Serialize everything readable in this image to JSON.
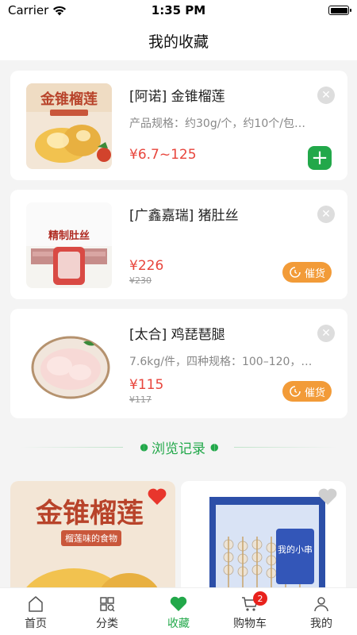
{
  "status": {
    "carrier": "Carrier",
    "time": "1:35 PM"
  },
  "page": {
    "title": "我的收藏"
  },
  "favorites": [
    {
      "title": "[阿诺] 金锥榴莲",
      "spec": "产品规格：约30g/个，约10个/包…",
      "price": "¥6.7~125",
      "old_price": "",
      "action": "add"
    },
    {
      "title": "[广鑫嘉瑞] 猪肚丝",
      "spec": "",
      "price": "¥226",
      "old_price": "¥230",
      "action": "催货"
    },
    {
      "title": "[太合] 鸡琵琶腿",
      "spec": "7.6kg/件，四种规格：100–120，…",
      "price": "¥115",
      "old_price": "¥117",
      "action": "催货"
    }
  ],
  "thumb_text": {
    "durian_title": "金锥榴莲",
    "durian_tag": "榴莲味的食物",
    "pork_label": "精制肚丝",
    "skewer_label": "我的小串"
  },
  "history": {
    "title": "浏览记录"
  },
  "tabs": [
    {
      "label": "首页",
      "icon": "home-icon"
    },
    {
      "label": "分类",
      "icon": "category-icon"
    },
    {
      "label": "收藏",
      "icon": "heart-icon"
    },
    {
      "label": "购物车",
      "icon": "cart-icon",
      "badge": "2"
    },
    {
      "label": "我的",
      "icon": "profile-icon"
    }
  ],
  "colors": {
    "accent": "#22a84a",
    "price": "#e8453c",
    "remind": "#f29b38",
    "badge": "#e8211c"
  }
}
